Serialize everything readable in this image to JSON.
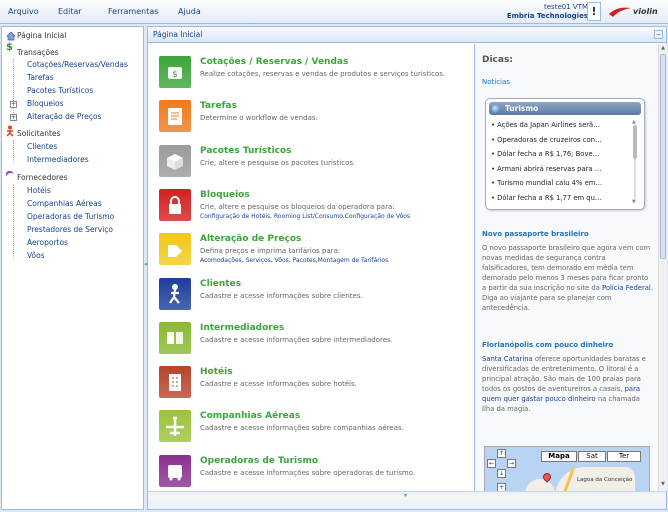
{
  "menu": [
    "Arquivo",
    "Editar",
    "Ferramentas",
    "Ajuda"
  ],
  "user": {
    "name": "teste01 VTM",
    "org": "Embria Technologies"
  },
  "alert_label": "!",
  "logo_text": "violin",
  "sidebar": {
    "home": "Página Inicial",
    "groups": [
      {
        "label": "Transações",
        "children": [
          "Cotações/Reservas/Vendas",
          "Tarefas",
          "Pacotes Turísticos",
          "Bloqueios",
          "Alteração de Preços"
        ]
      },
      {
        "label": "Solicitantes",
        "children": [
          "Clientes",
          "Intermediadores"
        ]
      },
      {
        "label": "Fornecedores",
        "children": [
          "Hotéis",
          "Companhias Aéreas",
          "Operadoras de Turismo",
          "Prestadores de Serviço",
          "Aeroportos",
          "Vôos"
        ]
      }
    ]
  },
  "main": {
    "title": "Página Inicial",
    "items": [
      {
        "title": "Cotações / Reservas / Vendas",
        "desc": "Realize cotações, reservas e vendas de produtos e serviços turísticos.",
        "links": "",
        "color": "#3aa637"
      },
      {
        "title": "Tarefas",
        "desc": "Determine o workflow de vendas.",
        "links": "",
        "color": "#f07a1c"
      },
      {
        "title": "Pacotes Turísticos",
        "desc": "Crie, altere e pesquise os pacotes turísticos.",
        "links": "",
        "color": "#9a9a9a"
      },
      {
        "title": "Bloqueios",
        "desc": "Crie, altere e pesquise os bloqueios da operadora para:",
        "links": "Configuração de Hotéis, Rooming List/Consumo,Configuração de Vôos",
        "color": "#d32020"
      },
      {
        "title": "Alteração de Preços",
        "desc": "Defina preços e imprima tarifários para:",
        "links": "Acomodações, Serviços, Vôos, Pacotes,Montagem de Tarifários",
        "color": "#f2c81a"
      },
      {
        "title": "Clientes",
        "desc": "Cadastre e acesse informações sobre clientes.",
        "links": "",
        "color": "#1b3f9c"
      },
      {
        "title": "Intermediadores",
        "desc": "Cadastre e acesse informações sobre intermediadores.",
        "links": "",
        "color": "#8ab833"
      },
      {
        "title": "Hotéis",
        "desc": "Cadastre e acesse informações sobre hotéis.",
        "links": "",
        "color": "#b8442a"
      },
      {
        "title": "Companhias Aéreas",
        "desc": "Cadastre e acesse informações sobre companhias aéreas.",
        "links": "",
        "color": "#9cc23a"
      },
      {
        "title": "Operadoras de Turismo",
        "desc": "Cadastre e acesse informações sobre operadoras de turismo.",
        "links": "",
        "color": "#8a2f8f"
      }
    ]
  },
  "tips": {
    "heading": "Dicas:",
    "sub": "Notícias",
    "news_title": "Turismo",
    "news": [
      "Ações da Japan Airlines serã…",
      "Operadoras de cruzeiros con…",
      "Dólar fecha a R$ 1,76; Bove…",
      "Armani abrirá reservas para …",
      "Turismo mundial caiu 4% em…",
      "Dólar fecha a R$ 1,77 em qu…"
    ],
    "tip1_title": "Novo passaporte brasileiro",
    "tip1_text": "O novo passaporte brasileiro que agora vem com novas medidas de segurança contra falsificadores, tem demorado em média tem demorado pelo menos 3 meses para ficar pronto a partir da sua inscrição no site da ",
    "tip1_link": "Polícia Federal",
    "tip1_text2": ". Diga ao viajante para se planejar com antecedência.",
    "tip2_title": "Florianópolis com pouco dinheiro",
    "tip2_link1": "Santa Catarina",
    "tip2_text": " oferece oportunidades baratas e diversificadas de entretenimento. O litoral é a principal atração. São mais de 100 praias para todos os gostos de aventureiros a casais, ",
    "tip2_link2": "para quem quer gastar pouco dinheiro",
    "tip2_text2": " na chamada Ilha da magia.",
    "map_types": [
      "Mapa",
      "Sat",
      "Ter"
    ],
    "map_place": "Lagoa da Conceição"
  }
}
